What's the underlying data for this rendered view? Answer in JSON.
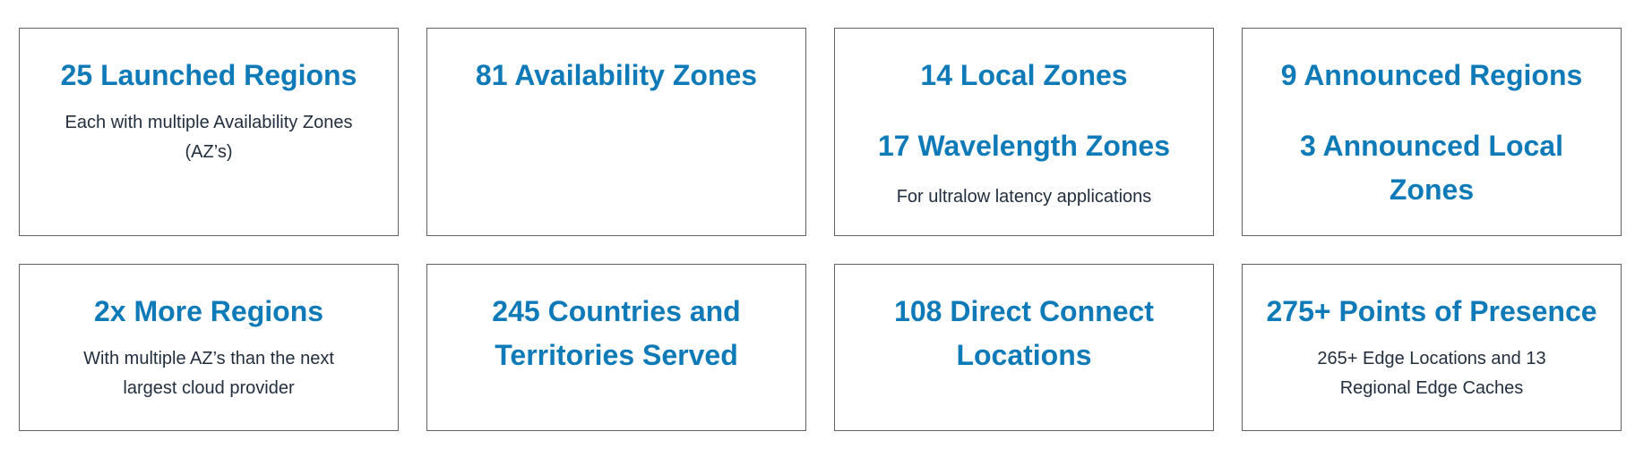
{
  "cards": [
    {
      "headlines": [
        "25 Launched Regions"
      ],
      "description": "Each with multiple Availability Zones (AZ’s)"
    },
    {
      "headlines": [
        "81 Availability Zones"
      ],
      "description": ""
    },
    {
      "headlines": [
        "14 Local Zones",
        "17 Wavelength Zones"
      ],
      "description": "For ultralow latency applications"
    },
    {
      "headlines": [
        "9 Announced Regions",
        "3 Announced Local Zones"
      ],
      "description": ""
    },
    {
      "headlines": [
        "2x More Regions"
      ],
      "description": "With multiple AZ’s than the next largest cloud provider"
    },
    {
      "headlines": [
        "245 Countries and Territories Served"
      ],
      "description": ""
    },
    {
      "headlines": [
        "108 Direct Connect Locations"
      ],
      "description": ""
    },
    {
      "headlines": [
        "275+ Points of Presence"
      ],
      "description": "265+ Edge Locations and 13 Regional Edge Caches"
    }
  ],
  "colors": {
    "headline": "#0f7ab8",
    "body_text": "#232f3e",
    "border": "#5f6368"
  }
}
